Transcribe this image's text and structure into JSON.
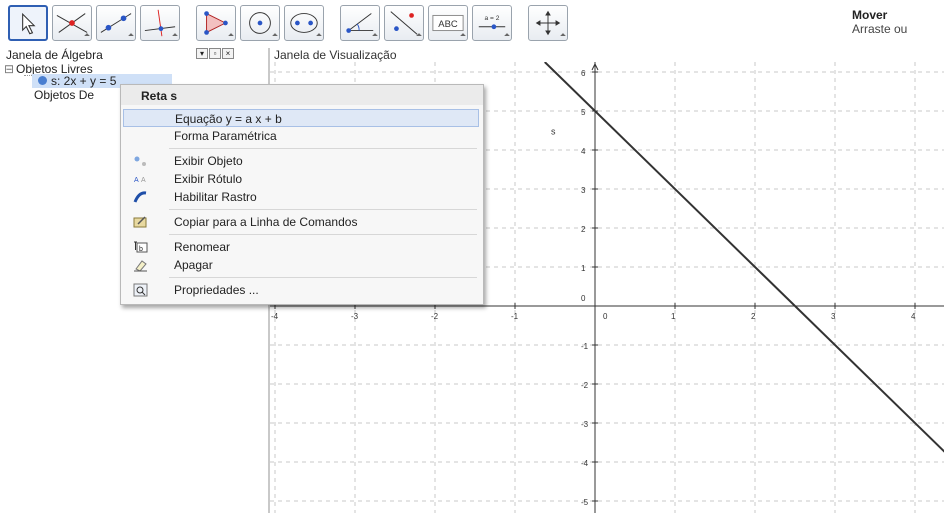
{
  "toolbar": {
    "tools": [
      {
        "name": "move-tool-button",
        "icon": "cursor-arrow-icon"
      },
      {
        "name": "point-tool-button",
        "icon": "intersect-lines-icon"
      },
      {
        "name": "line-tool-button",
        "icon": "line-through-two-points-icon"
      },
      {
        "name": "perpendicular-tool-button",
        "icon": "perpendicular-line-icon"
      },
      {
        "name": "polygon-tool-button",
        "icon": "polygon-icon"
      },
      {
        "name": "circle-tool-button",
        "icon": "circle-center-point-icon"
      },
      {
        "name": "conic-tool-button",
        "icon": "ellipse-icon"
      },
      {
        "name": "angle-tool-button",
        "icon": "angle-icon"
      },
      {
        "name": "reflect-tool-button",
        "icon": "reflect-about-line-icon"
      },
      {
        "name": "text-tool-button",
        "icon": "text-abc-icon"
      },
      {
        "name": "slider-tool-button",
        "icon": "slider-icon"
      },
      {
        "name": "move-view-tool-button",
        "icon": "move-graphics-view-icon"
      }
    ],
    "mode_title": "Mover",
    "mode_help": "Arraste ou"
  },
  "algebra": {
    "title": "Janela de Álgebra",
    "free_objects": "Objetos Livres",
    "object_s": "s: 2x + y = 5",
    "dependent_objects": "Objetos De"
  },
  "graphics": {
    "title": "Janela de Visualização",
    "line_label": "s",
    "x_ticks": [
      "-4",
      "-3",
      "-2",
      "-1",
      "0",
      "1",
      "2",
      "3",
      "4"
    ],
    "y_ticks": [
      "6",
      "5",
      "4",
      "3",
      "2",
      "1",
      "0",
      "-1",
      "-2",
      "-3",
      "-4",
      "-5"
    ],
    "line_color": "#333333",
    "grid_color": "#c8c8c8"
  },
  "context_menu": {
    "title": "Reta s",
    "items": [
      {
        "label": "Equação y = a x + b",
        "icon": "",
        "highlighted": true
      },
      {
        "label": "Forma Paramétrica",
        "icon": ""
      },
      {
        "label": "Exibir Objeto",
        "icon": "show-object-icon"
      },
      {
        "label": "Exibir Rótulo",
        "icon": "show-label-icon"
      },
      {
        "label": "Habilitar Rastro",
        "icon": "trace-icon"
      },
      {
        "label": "Copiar para a Linha de Comandos",
        "icon": "copy-to-input-icon"
      },
      {
        "label": "Renomear",
        "icon": "rename-icon"
      },
      {
        "label": "Apagar",
        "icon": "delete-eraser-icon"
      },
      {
        "label": "Propriedades ...",
        "icon": "properties-icon"
      }
    ]
  }
}
